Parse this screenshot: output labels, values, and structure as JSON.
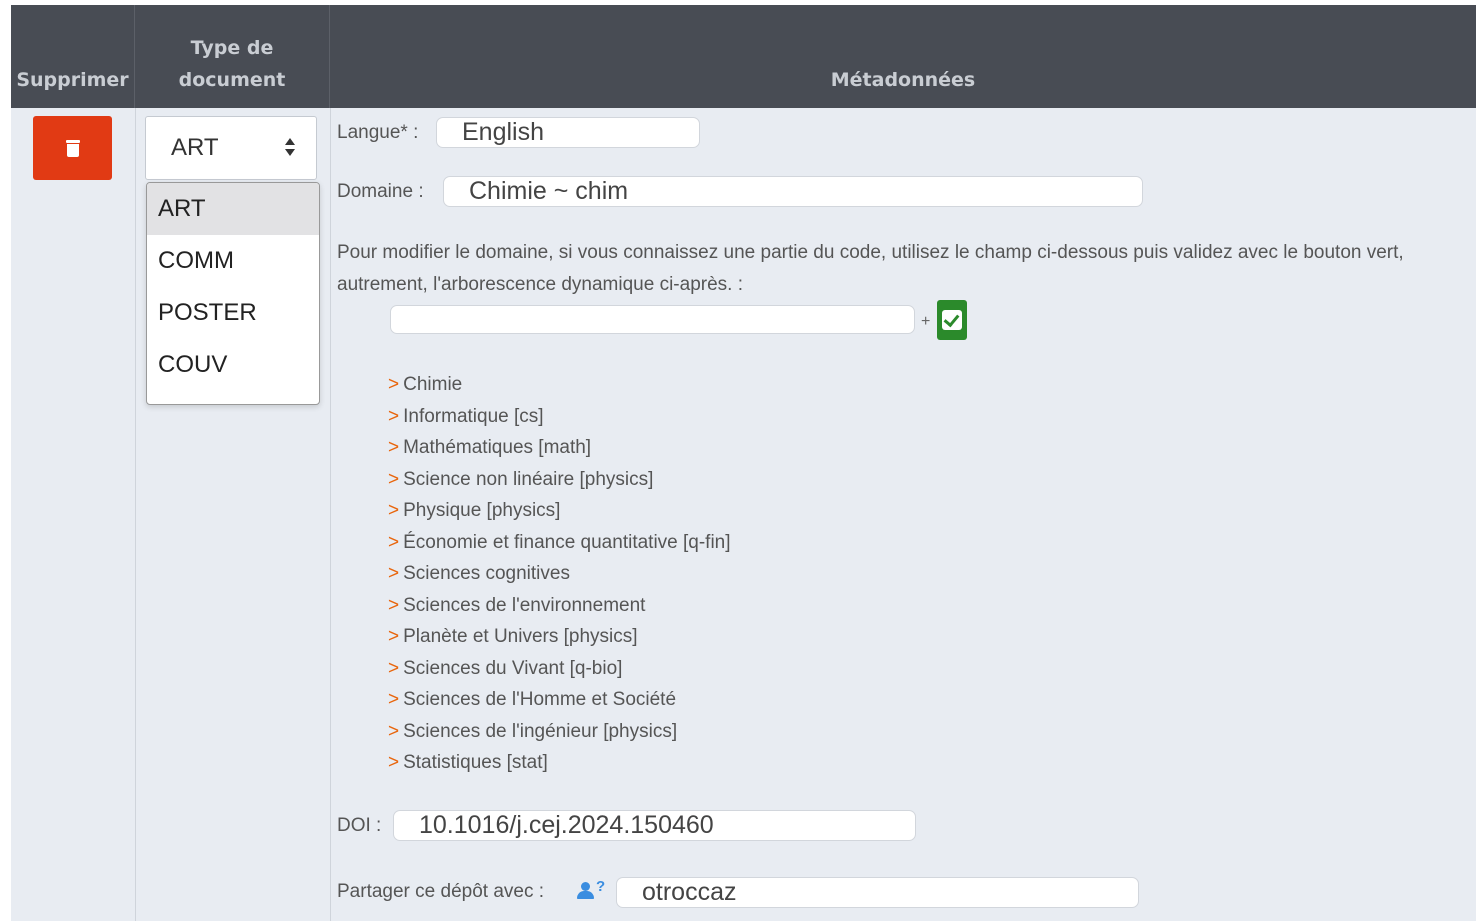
{
  "table": {
    "headers": {
      "delete": "Supprimer",
      "doc_type_line1": "Type de",
      "doc_type_line2": "document",
      "metadata": "Métadonnées"
    }
  },
  "doc_type": {
    "selected": "ART",
    "options": [
      "ART",
      "COMM",
      "POSTER",
      "COUV"
    ]
  },
  "metadata": {
    "language_label": "Langue* :",
    "language_value": "English",
    "domain_label": "Domaine :",
    "domain_value": "Chimie ~ chim",
    "domain_help": "Pour modifier le domaine, si vous connaissez une partie du code, utilisez le champ ci-dessous puis validez avec le bouton vert, autrement, l'arborescence dynamique ci-après. :",
    "code_input_value": "",
    "plus_sign": "+",
    "tree": [
      "Chimie",
      "Informatique [cs]",
      "Mathématiques [math]",
      "Science non linéaire [physics]",
      "Physique [physics]",
      "Économie et finance quantitative [q-fin]",
      "Sciences cognitives",
      "Sciences de l'environnement",
      "Planète et Univers [physics]",
      "Sciences du Vivant [q-bio]",
      "Sciences de l'Homme et Société",
      "Sciences de l'ingénieur [physics]",
      "Statistiques [stat]"
    ],
    "tree_marker": ">",
    "doi_label": "DOI :",
    "doi_value": "10.1016/j.cej.2024.150460",
    "share_label": "Partager ce dépôt avec :",
    "share_value": "otroccaz"
  },
  "icons": {
    "delete": "trash-icon",
    "validate": "check-icon",
    "share": "user-question-icon",
    "select": "sort-arrows-icon"
  },
  "colors": {
    "header_bg": "#484c54",
    "delete_button": "#e13a14",
    "validate_button": "#2b8a2b",
    "tree_marker": "#e8650c",
    "user_icon": "#3a8de0"
  }
}
